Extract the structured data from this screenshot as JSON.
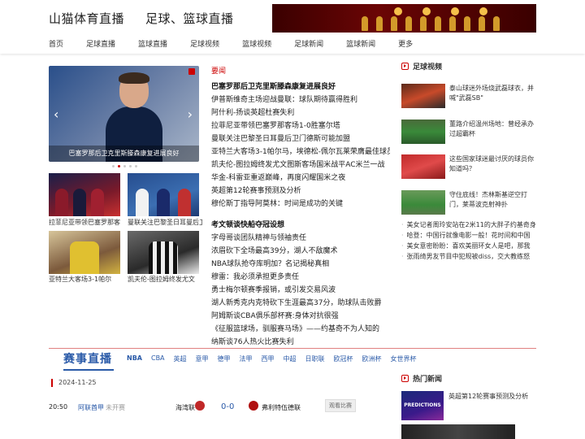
{
  "header": {
    "logo_title": "山猫体育直播",
    "logo_subtitle": "足球、篮球直播"
  },
  "nav": [
    "首页",
    "足球直播",
    "篮球直播",
    "足球视频",
    "篮球视频",
    "足球新闻",
    "篮球新闻",
    "更多"
  ],
  "carousel": {
    "caption": "巴塞罗那后卫克里斯滕森康复进展良好",
    "slide_count": 5,
    "active_slide": 1
  },
  "thumbs": [
    {
      "caption": "拉菲尼亚带领巴塞罗那客"
    },
    {
      "caption": "曼联关注巴黎圣日耳曼后卫"
    },
    {
      "caption": "亚特兰大客场3-1帕尔"
    },
    {
      "caption": "凯夫伦-图拉姆终发尤文"
    }
  ],
  "news": {
    "section_title": "要闻",
    "group1": [
      {
        "text": "巴塞罗那后卫克里斯滕森康复进展良好",
        "bold": true
      },
      {
        "text": "伊普斯维奇主场迎战曼联：球队期待赢得胜利",
        "bold": false
      },
      {
        "text": "阿什利-扬谈英超杜赛失利",
        "bold": false
      },
      {
        "text": "拉菲尼亚带领巴塞罗那客场1-0胜塞尔塔",
        "bold": false
      },
      {
        "text": "曼联关注巴黎圣日耳曼后卫门德斯可能加盟",
        "bold": false
      },
      {
        "text": "亚特兰大客场3-1帕尔马，埃德松-佩尔瓦莱荣膺最佳球员",
        "bold": false
      },
      {
        "text": "凯夫伦-图拉姆终发尤文图斯客场国米战平AC米兰一战",
        "bold": false
      },
      {
        "text": "华金-科雷亚重返巅峰，再度闪耀国米之夜",
        "bold": false
      },
      {
        "text": "英超第12轮赛事预测及分析",
        "bold": false
      },
      {
        "text": "穆伦斯丁指导阿莫林：时间是成功的关键",
        "bold": false
      }
    ],
    "group2": [
      {
        "text": "考文顿谈快船夺冠设想",
        "bold": true
      },
      {
        "text": "字母哥谈团队精神与领袖责任",
        "bold": false
      },
      {
        "text": "浓眉砍下全场最高39分，湖人不敌魔术",
        "bold": false
      },
      {
        "text": "NBA球队抢夺库明加？名记揭秘真相",
        "bold": false
      },
      {
        "text": "穆雷：我必须承担更多责任",
        "bold": false
      },
      {
        "text": "勇士梅尔顿赛季报销，或引发交易风波",
        "bold": false
      },
      {
        "text": "湖人新秀克内克特砍下生涯最高37分，助球队击败爵",
        "bold": false
      },
      {
        "text": "阿姆斯谈CBA俱乐部杯赛:身体对抗很强",
        "bold": false
      },
      {
        "text": "《征服篮球场，驯服赛马场》——约基奇不为人知的",
        "bold": false
      },
      {
        "text": "纳斯谈76人热火比赛失利",
        "bold": false
      }
    ]
  },
  "videos": {
    "title": "足球视频",
    "items": [
      {
        "text": "泰山球迷外场烧武磊球衣，并喊\"武磊SB\""
      },
      {
        "text": "董路介绍温州场地：曾经承办过超霸杯"
      },
      {
        "text": "这些国家球迷最讨厌的球员你知道吗？"
      },
      {
        "text": "守住底线！杰林斯基逆空打门，莱蒂波克射神扑"
      }
    ],
    "list": [
      "美女记者周玲安站在2米11的大胖子约基奇身",
      "哈登：中国行就像电影一般！花时间和中国",
      "美女意密盼盼：喜欢美丽环女人是吧，那我",
      "张雨绮男友节目中犯规被diss，交大教练怒"
    ]
  },
  "live": {
    "title": "赛事直播",
    "tabs": [
      "NBA",
      "CBA",
      "英超",
      "意甲",
      "德甲",
      "法甲",
      "西甲",
      "中超",
      "日职联",
      "欧冠杯",
      "欧洲杯",
      "女世界杯"
    ],
    "date": "2024-11-25",
    "match": {
      "time": "20:50",
      "league": "阿联酋甲",
      "status": "未开赛",
      "home": "海湾联",
      "score": "0-0",
      "away": "弗利特伍德联",
      "watch_label": "观看比赛",
      "home_color": "#c02828",
      "away_color": "#b01010"
    }
  },
  "hot_news": {
    "title": "热门新闻",
    "image_text": "PREDICTIONS",
    "first": "英超第12轮赛事预测及分析"
  }
}
